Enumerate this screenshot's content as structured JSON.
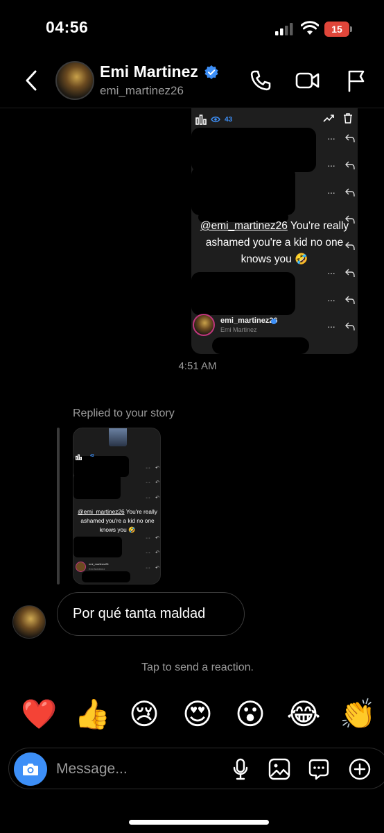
{
  "status_bar": {
    "time": "04:56",
    "battery": "15"
  },
  "header": {
    "name": "Emi Martinez",
    "handle": "emi_martinez26",
    "icons": [
      "back-icon",
      "phone-icon",
      "video-icon",
      "flag-icon",
      "verified-icon"
    ]
  },
  "story": {
    "views": "43",
    "mention": "@emi_martinez26",
    "text_line1": "You're really",
    "text_line2": "ashamed you're a kid  no one",
    "text_line3": "knows you",
    "emoji": "🤣",
    "account_name": "emi_martinez26",
    "account_sub": "Emi Martinez"
  },
  "timestamp": "4:51 AM",
  "reply": {
    "label": "Replied to your story"
  },
  "message": {
    "text": "Por qué tanta maldad"
  },
  "reaction_hint": "Tap to send a reaction.",
  "reactions": [
    "❤️",
    "👍",
    "😢",
    "😍",
    "😮",
    "😂",
    "👏"
  ],
  "composer": {
    "placeholder": "Message..."
  },
  "colors": {
    "accent": "#3d8ff7",
    "battery": "#e0463a",
    "background": "#000000"
  }
}
